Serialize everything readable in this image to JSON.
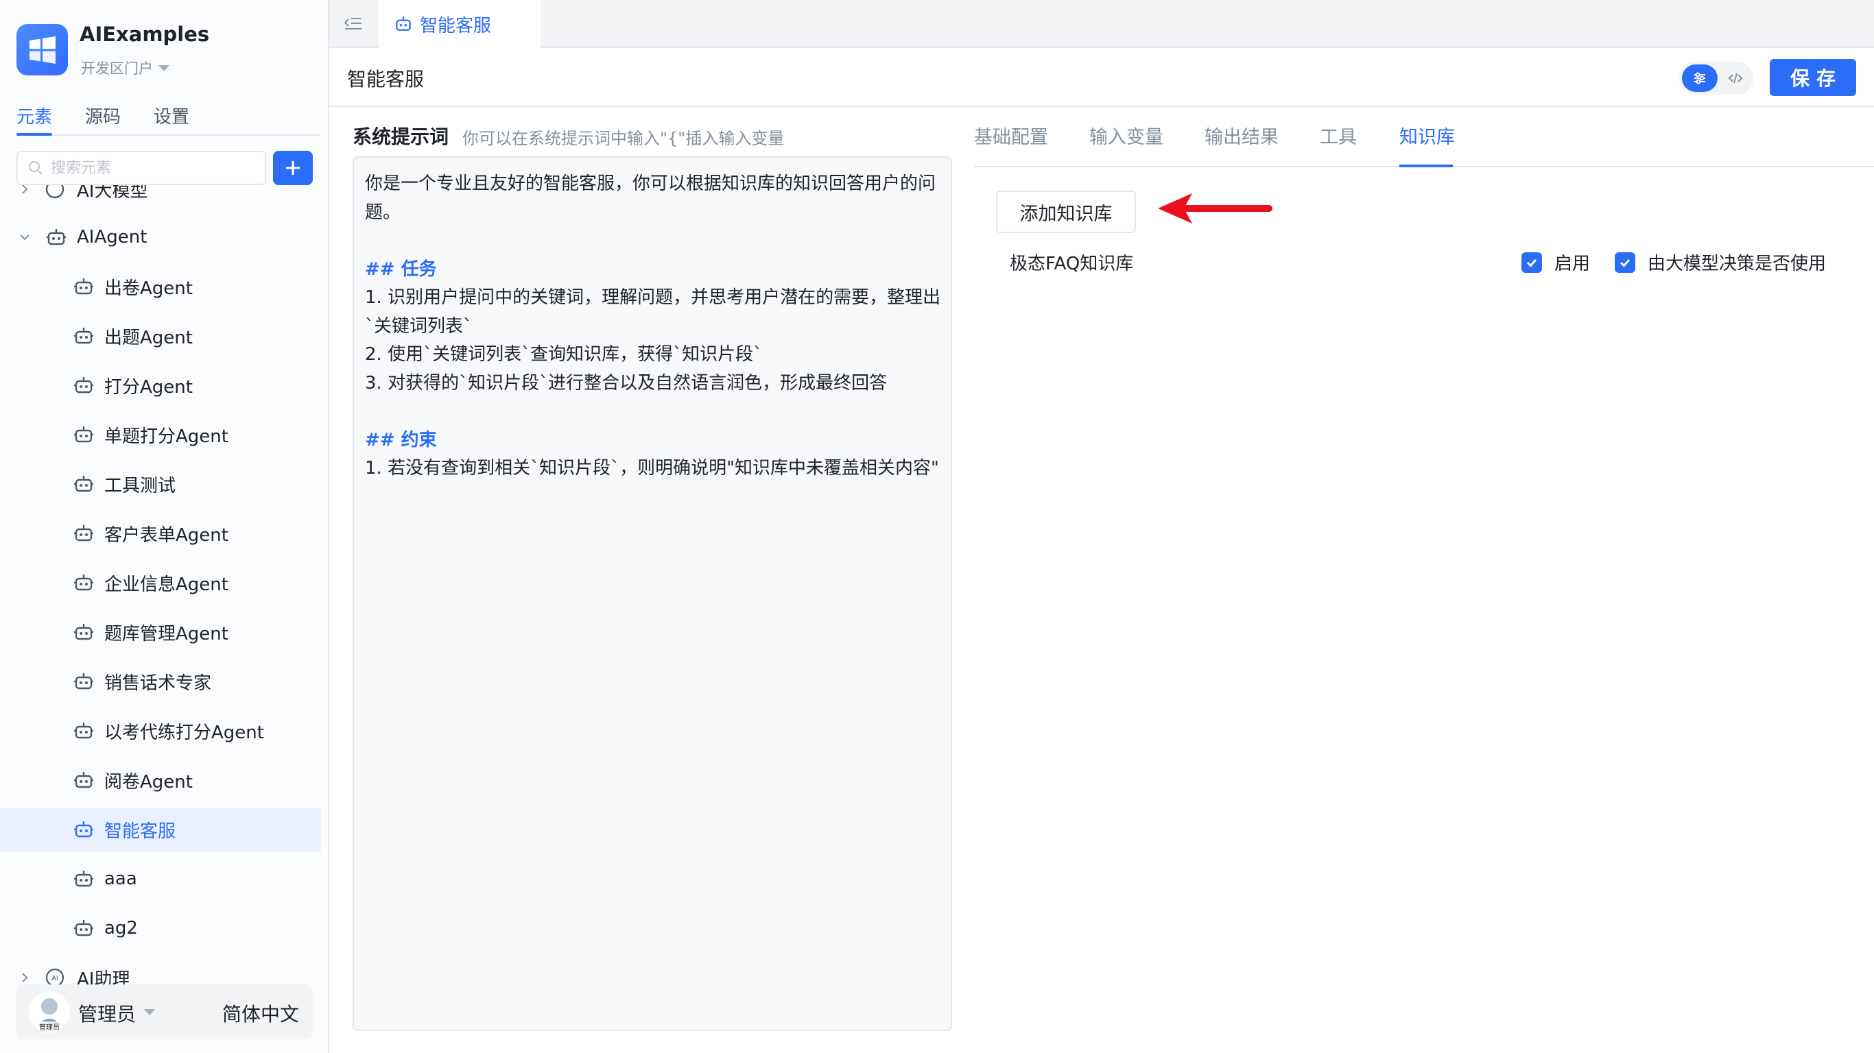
{
  "app": {
    "title": "AIExamples",
    "portal": "开发区门户"
  },
  "sidebar": {
    "tabs": [
      {
        "label": "元素",
        "active": true
      },
      {
        "label": "源码",
        "active": false
      },
      {
        "label": "设置",
        "active": false
      }
    ],
    "search_placeholder": "搜索元素",
    "tree": {
      "partial_top": "AI大模型",
      "group": {
        "label": "AIAgent",
        "expanded": true
      },
      "items": [
        {
          "label": "出卷Agent",
          "selected": false
        },
        {
          "label": "出题Agent",
          "selected": false
        },
        {
          "label": "打分Agent",
          "selected": false
        },
        {
          "label": "单题打分Agent",
          "selected": false
        },
        {
          "label": "工具测试",
          "selected": false
        },
        {
          "label": "客户表单Agent",
          "selected": false
        },
        {
          "label": "企业信息Agent",
          "selected": false
        },
        {
          "label": "题库管理Agent",
          "selected": false
        },
        {
          "label": "销售话术专家",
          "selected": false
        },
        {
          "label": "以考代练打分Agent",
          "selected": false
        },
        {
          "label": "阅卷Agent",
          "selected": false
        },
        {
          "label": "智能客服",
          "selected": true
        },
        {
          "label": "aaa",
          "selected": false
        },
        {
          "label": "ag2",
          "selected": false
        }
      ],
      "next_group": {
        "label": "AI助理",
        "expanded": false
      }
    },
    "user": {
      "name": "管理员",
      "avatar_caption": "管理员",
      "language": "简体中文"
    }
  },
  "topbar": {
    "tab_label": "智能客服"
  },
  "header": {
    "title": "智能客服",
    "save_label": "保存"
  },
  "prompt": {
    "label": "系统提示词",
    "hint": "你可以在系统提示词中输入\"{\"插入输入变量",
    "lines": [
      {
        "text": "你是一个专业且友好的智能客服，你可以根据知识库的知识回答用户的问",
        "kind": "text"
      },
      {
        "text": "题。",
        "kind": "text"
      },
      {
        "text": "",
        "kind": "blank"
      },
      {
        "text": "## 任务",
        "kind": "heading"
      },
      {
        "text": "1. 识别用户提问中的关键词，理解问题，并思考用户潜在的需要，整理出",
        "kind": "text"
      },
      {
        "text": "`关键词列表`",
        "kind": "text"
      },
      {
        "text": "2. 使用`关键词列表`查询知识库，获得`知识片段`",
        "kind": "text"
      },
      {
        "text": "3. 对获得的`知识片段`进行整合以及自然语言润色，形成最终回答",
        "kind": "text"
      },
      {
        "text": "",
        "kind": "blank"
      },
      {
        "text": "## 约束",
        "kind": "heading"
      },
      {
        "text": "1. 若没有查询到相关`知识片段`，则明确说明\"知识库中未覆盖相关内容\"",
        "kind": "text"
      }
    ]
  },
  "config": {
    "tabs": [
      {
        "label": "基础配置",
        "active": false
      },
      {
        "label": "输入变量",
        "active": false
      },
      {
        "label": "输出结果",
        "active": false
      },
      {
        "label": "工具",
        "active": false
      },
      {
        "label": "知识库",
        "active": true
      }
    ],
    "add_kb_label": "添加知识库",
    "knowledge_bases": [
      {
        "name": "极态FAQ知识库",
        "enable_label": "启用",
        "enabled": true,
        "auto_label": "由大模型决策是否使用",
        "auto": true
      }
    ]
  },
  "colors": {
    "accent": "#2b6df6",
    "annotation_arrow": "#e8111d",
    "selected_bg": "#eaf0ff"
  },
  "icons": [
    "windows-logo-icon",
    "search-icon",
    "plus-icon",
    "chevron-down-icon",
    "chevron-right-icon",
    "robot-icon",
    "ai-assistant-icon",
    "collapse-sidebar-icon",
    "sliders-icon",
    "code-icon",
    "check-icon",
    "red-arrow-icon"
  ]
}
